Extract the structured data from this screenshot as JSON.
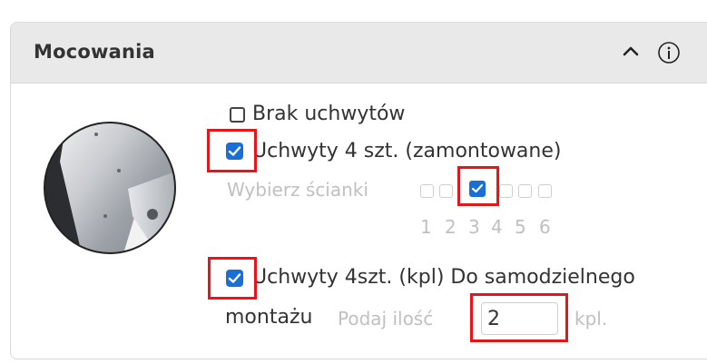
{
  "panel": {
    "title": "Mocowania",
    "collapse_icon": "chevron-up-icon",
    "info_icon": "info-icon"
  },
  "options": {
    "none": {
      "label": "Brak uchwytów",
      "checked": false
    },
    "mounted": {
      "label": "Uchwyty 4 szt. (zamontowane)",
      "checked": true
    },
    "kit": {
      "label": "Uchwyty 4szt. (kpl) Do samodzielnego",
      "label_cont": "montażu",
      "checked": true
    }
  },
  "walls": {
    "label": "Wybierz ścianki",
    "numbers": [
      "1",
      "2",
      "3",
      "4",
      "5",
      "6"
    ],
    "checked_index": 2
  },
  "quantity": {
    "label": "Podaj ilość",
    "value": "2",
    "unit": "kpl."
  },
  "colors": {
    "accent": "#1a6fd6",
    "highlight": "#e8141a",
    "header_bg": "#e9e9e9",
    "muted_text": "#c0c0c0"
  }
}
